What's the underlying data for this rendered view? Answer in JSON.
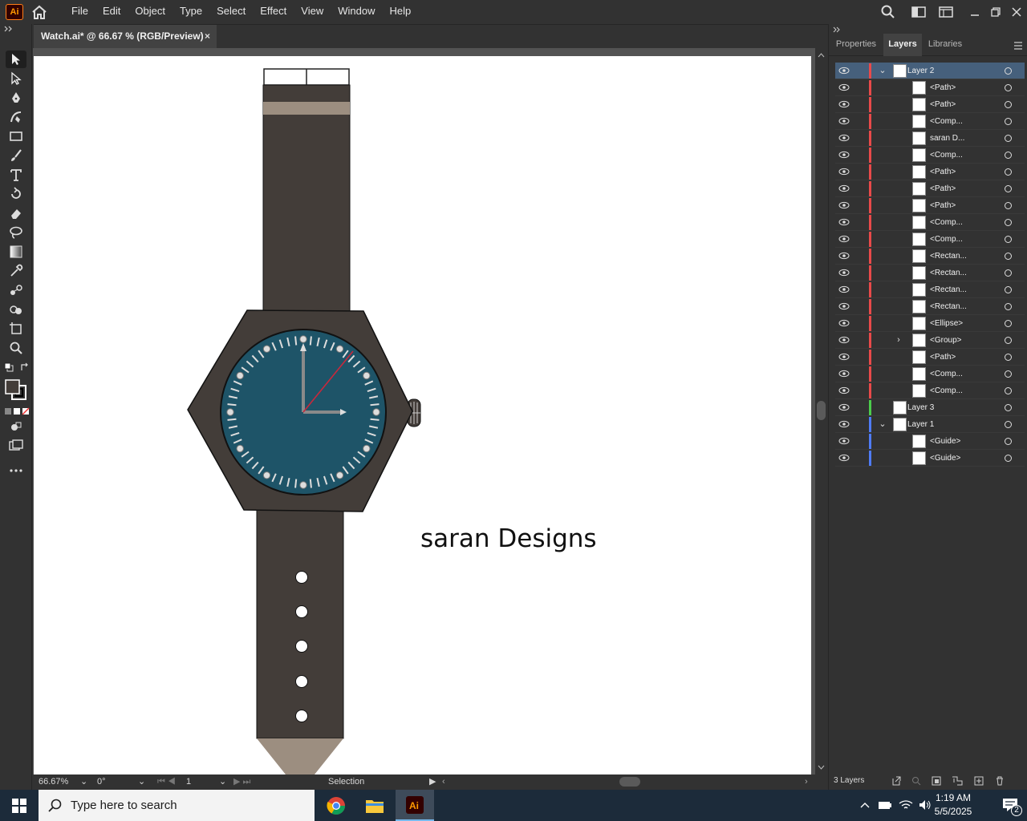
{
  "app": {
    "logo": "Ai",
    "menu": [
      "File",
      "Edit",
      "Object",
      "Type",
      "Select",
      "Effect",
      "View",
      "Window",
      "Help"
    ]
  },
  "document": {
    "tab_title": "Watch.ai* @ 66.67 % (RGB/Preview)",
    "close_glyph": "×"
  },
  "canvas": {
    "text": "saran Designs"
  },
  "status": {
    "zoom": "66.67%",
    "rotation": "0°",
    "artboard": "1",
    "tool": "Selection"
  },
  "panel": {
    "tabs": [
      "Properties",
      "Layers",
      "Libraries"
    ],
    "active_tab": "Layers",
    "layers_count": "3 Layers",
    "rows": [
      {
        "name": "Layer 2",
        "level": 0,
        "expanded": true,
        "color": "#e94a4a",
        "selected": true
      },
      {
        "name": "<Path>",
        "level": 1,
        "color": "#e94a4a"
      },
      {
        "name": "<Path>",
        "level": 1,
        "color": "#e94a4a"
      },
      {
        "name": "<Comp...",
        "level": 1,
        "color": "#e94a4a"
      },
      {
        "name": "saran D...",
        "level": 1,
        "color": "#e94a4a"
      },
      {
        "name": "<Comp...",
        "level": 1,
        "color": "#e94a4a"
      },
      {
        "name": "<Path>",
        "level": 1,
        "color": "#e94a4a"
      },
      {
        "name": "<Path>",
        "level": 1,
        "color": "#e94a4a"
      },
      {
        "name": "<Path>",
        "level": 1,
        "color": "#e94a4a"
      },
      {
        "name": "<Comp...",
        "level": 1,
        "color": "#e94a4a"
      },
      {
        "name": "<Comp...",
        "level": 1,
        "color": "#e94a4a"
      },
      {
        "name": "<Rectan...",
        "level": 1,
        "color": "#e94a4a"
      },
      {
        "name": "<Rectan...",
        "level": 1,
        "color": "#e94a4a"
      },
      {
        "name": "<Rectan...",
        "level": 1,
        "color": "#e94a4a"
      },
      {
        "name": "<Rectan...",
        "level": 1,
        "color": "#e94a4a"
      },
      {
        "name": "<Ellipse>",
        "level": 1,
        "color": "#e94a4a"
      },
      {
        "name": "<Group>",
        "level": 1,
        "color": "#e94a4a",
        "collapsed_group": true
      },
      {
        "name": "<Path>",
        "level": 1,
        "color": "#e94a4a"
      },
      {
        "name": "<Comp...",
        "level": 1,
        "color": "#e94a4a"
      },
      {
        "name": "<Comp...",
        "level": 1,
        "color": "#e94a4a"
      },
      {
        "name": "Layer 3",
        "level": 0,
        "color": "#4ccc4c"
      },
      {
        "name": "Layer 1",
        "level": 0,
        "expanded": true,
        "color": "#4f7cf7"
      },
      {
        "name": "<Guide>",
        "level": 1,
        "color": "#4f7cf7"
      },
      {
        "name": "<Guide>",
        "level": 1,
        "color": "#4f7cf7"
      }
    ]
  },
  "taskbar": {
    "search_placeholder": "Type here to search",
    "time": "1:19 AM",
    "date": "5/5/2025",
    "notifications": "2"
  },
  "colors": {
    "strap": "#433d39",
    "dial": "#1e5468",
    "keeper": "#9c8e80",
    "second_hand": "#c8283c"
  }
}
